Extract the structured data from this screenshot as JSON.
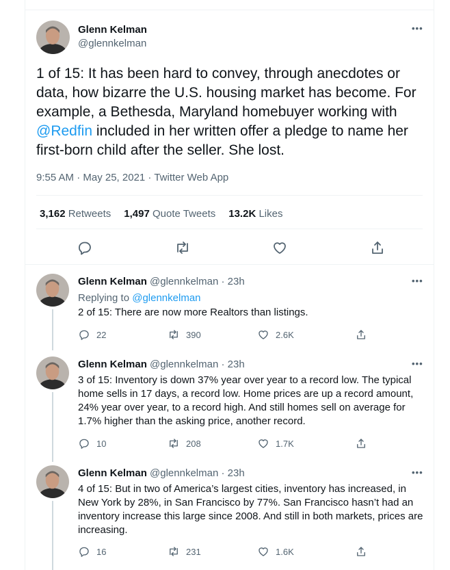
{
  "main_tweet": {
    "author_name": "Glenn Kelman",
    "author_handle": "@glennkelman",
    "text_before_mention": "1 of 15: It has been hard to convey, through anecdotes or data, how bizarre the U.S. housing market has become. For example, a Bethesda, Maryland homebuyer working with ",
    "mention": "@Redfin",
    "text_after_mention": " included in her written offer a pledge to name her first-born child after the seller. She lost.",
    "meta": "9:55 AM · May 25, 2021 · Twitter Web App",
    "stats": {
      "retweets_count": "3,162",
      "retweets_label": "Retweets",
      "quotes_count": "1,497",
      "quotes_label": "Quote Tweets",
      "likes_count": "13.2K",
      "likes_label": "Likes"
    },
    "more": "•••"
  },
  "replies": [
    {
      "name": "Glenn Kelman",
      "handle_time": "@glennkelman · 23h",
      "replying_prefix": "Replying to ",
      "replying_to": "@glennkelman",
      "text": "2 of 15: There are now more Realtors than listings.",
      "reply_count": "22",
      "retweet_count": "390",
      "like_count": "2.6K",
      "more": "•••"
    },
    {
      "name": "Glenn Kelman",
      "handle_time": "@glennkelman · 23h",
      "text": "3 of 15: Inventory is down 37% year over year to a record low. The typical home sells in 17 days, a record low. Home prices are up a record amount, 24% year over year, to a record high. And still homes sell on average for 1.7% higher than the asking price, another record.",
      "reply_count": "10",
      "retweet_count": "208",
      "like_count": "1.7K",
      "more": "•••"
    },
    {
      "name": "Glenn Kelman",
      "handle_time": "@glennkelman · 23h",
      "text": "4 of 15: But in two of America’s largest cities, inventory has increased, in New York by 28%, in San Francisco by 77%. San Francisco hasn’t had an inventory increase this large since 2008. And still in both markets, prices are increasing.",
      "reply_count": "16",
      "retweet_count": "231",
      "like_count": "1.6K",
      "more": "•••"
    }
  ],
  "colors": {
    "accent": "#1d9bf0",
    "muted": "#536471",
    "text": "#0f1419",
    "border": "#eff3f4"
  },
  "icons": [
    "reply-icon",
    "retweet-icon",
    "like-icon",
    "share-icon"
  ]
}
